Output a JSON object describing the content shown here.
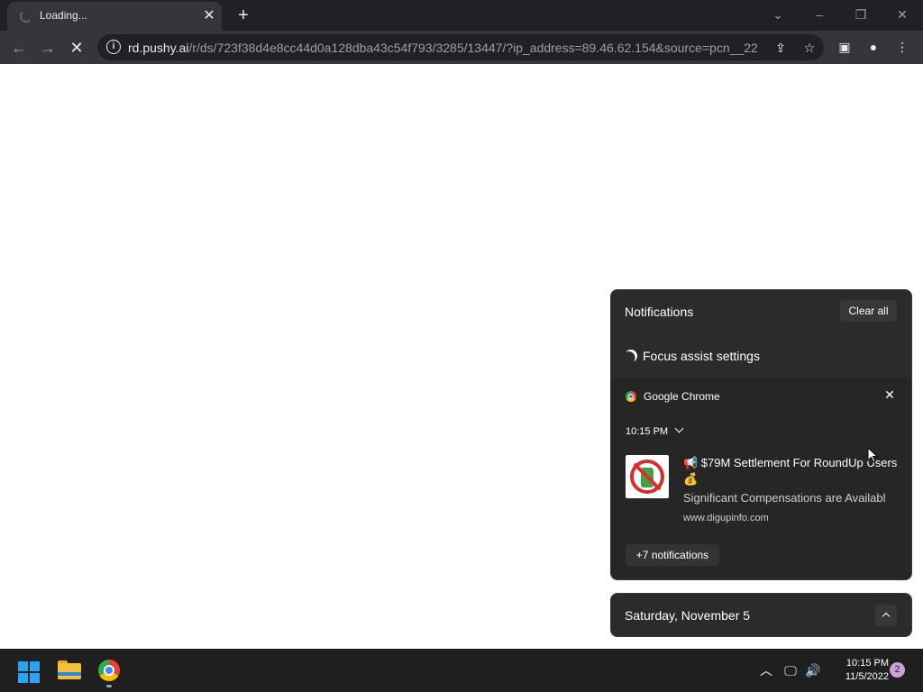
{
  "browser": {
    "tab": {
      "title": "Loading..."
    },
    "url": {
      "host": "rd.pushy.ai",
      "path": "/r/ds/723f38d4e8cc44d0a128dba43c54f793/3285/13447/?ip_address=89.46.62.154&source=pcn__22..."
    },
    "window_controls": [
      "chevron-down-icon",
      "minimize-icon",
      "restore-icon",
      "close-icon"
    ],
    "toolbar_icons": [
      "back-icon",
      "forward-icon",
      "stop-icon",
      "share-icon",
      "star-icon",
      "side-panel-icon",
      "profile-icon",
      "menu-icon"
    ]
  },
  "notification_center": {
    "title": "Notifications",
    "clear_all": "Clear all",
    "focus_assist": "Focus assist settings",
    "card": {
      "app_name": "Google Chrome",
      "time": "10:15 PM",
      "title": "📢 $79M Settlement For RoundUp Users 💰",
      "body": "Significant Compensations are Availabl",
      "site": "www.digupinfo.com",
      "more": "+7 notifications"
    }
  },
  "calendar": {
    "date": "Saturday, November 5"
  },
  "taskbar": {
    "clock_time": "10:15 PM",
    "clock_date": "11/5/2022",
    "badge_count": "2",
    "accent": "#2aa3f0"
  }
}
